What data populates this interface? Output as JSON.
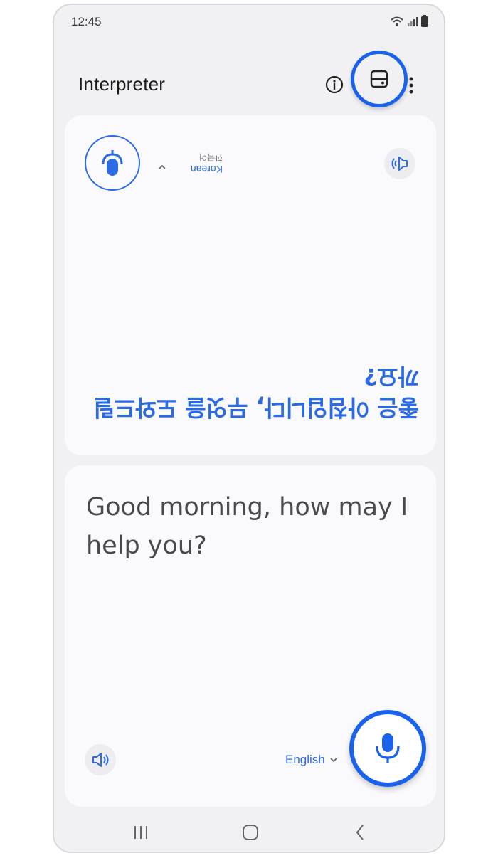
{
  "status_bar": {
    "time": "12:45",
    "icons": [
      "wifi-icon",
      "signal-icon",
      "battery-icon"
    ]
  },
  "app_bar": {
    "title": "Interpreter",
    "actions": [
      "info-icon",
      "layout-toggle-icon",
      "more-options-icon"
    ]
  },
  "top_panel": {
    "orientation": "rotated-180",
    "language": "Korean",
    "language_native": "한국어",
    "text": "좋은 아침입니다, 무엇을 도와드릴까요?"
  },
  "bottom_panel": {
    "text": "Good morning, how may I help you?",
    "language": "English"
  },
  "colors": {
    "accent": "#1a62ea",
    "text_blue": "#2c6ae2",
    "panel_bg": "#fafafd",
    "screen_bg": "#f1f1f4"
  },
  "nav_bar": {
    "icons": [
      "recent-apps-icon",
      "home-icon",
      "back-icon"
    ]
  }
}
